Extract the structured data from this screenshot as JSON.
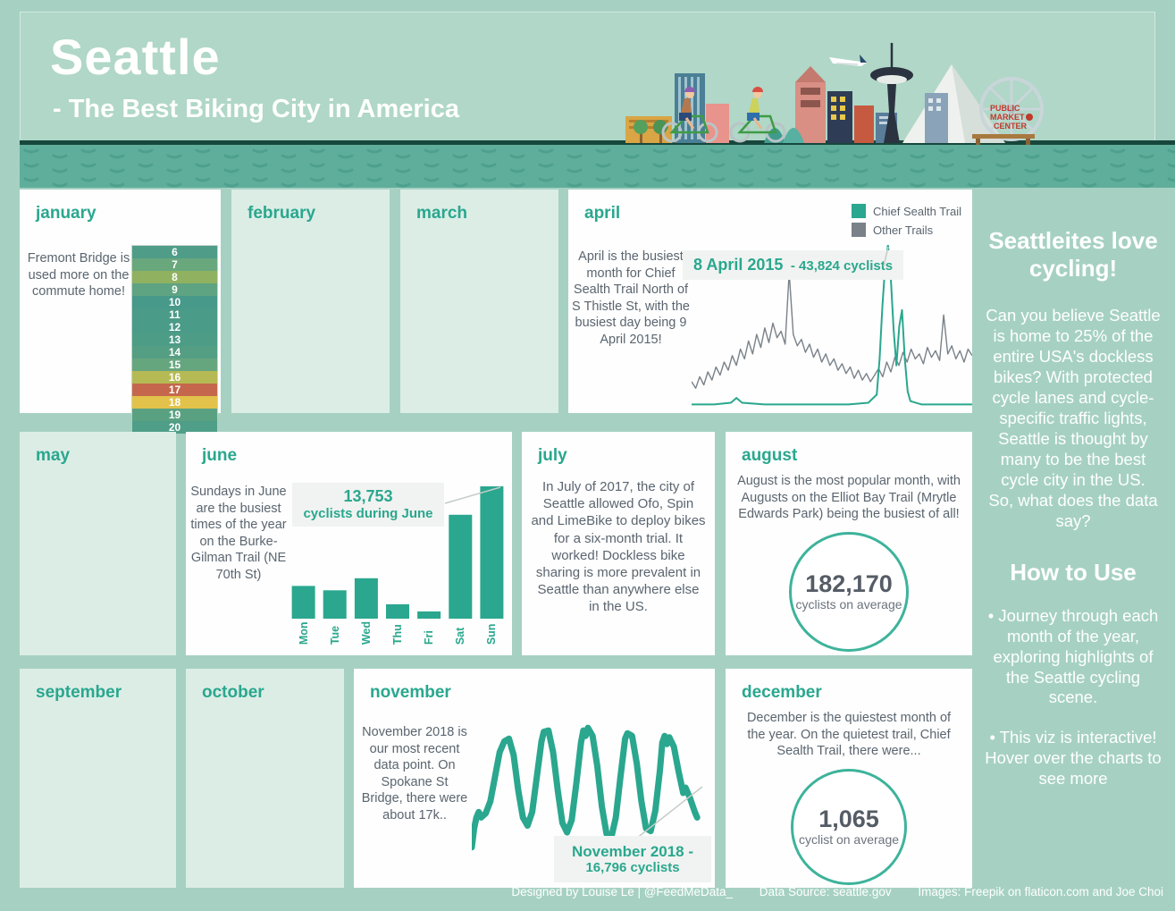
{
  "page": {
    "background": "#a6d1c2",
    "accent": "#2aa78e",
    "text_gray": "#5b6570"
  },
  "header": {
    "title": "Seattle",
    "subtitle": "- The Best Biking City in America",
    "illustration": {
      "sign_lines": [
        "PUBLIC",
        "MARKET",
        "CENTER"
      ]
    }
  },
  "months": {
    "january": {
      "title": "january",
      "text": "Fremont Bridge is used more on the commute home!"
    },
    "february": {
      "title": "february"
    },
    "march": {
      "title": "march"
    },
    "april": {
      "title": "april",
      "text": "April is the busiest month for Chief Sealth Trail North of S Thistle St, with the busiest day being 9 April 2015!",
      "legend": [
        {
          "label": "Chief Sealth Trail",
          "color": "#2aa78e"
        },
        {
          "label": "Other Trails",
          "color": "#7a8189"
        }
      ],
      "callout_date": "8 April 2015",
      "callout_value": "- 43,824 cyclists"
    },
    "may": {
      "title": "may"
    },
    "june": {
      "title": "june",
      "text": "Sundays in June are the busiest times of the year on the Burke-Gilman Trail (NE 70th St)",
      "callout_value": "13,753",
      "callout_label": "cyclists during June"
    },
    "july": {
      "title": "july",
      "text": "In July of 2017, the city of Seattle allowed Ofo, Spin and LimeBike to deploy bikes for a six-month trial. It worked! Dockless bike sharing is more prevalent in Seattle than anywhere else in the US."
    },
    "august": {
      "title": "august",
      "text": "August is the most popular month, with Augusts on the Elliot Bay Trail (Mrytle Edwards Park) being the busiest of all!",
      "stat_value": "182,170",
      "stat_label": "cyclists on average"
    },
    "september": {
      "title": "september"
    },
    "october": {
      "title": "october"
    },
    "november": {
      "title": "november",
      "text": "November 2018 is our most recent data point. On Spokane St Bridge, there were about 17k..",
      "callout_date": "November 2018 -",
      "callout_value": "16,796 cyclists"
    },
    "december": {
      "title": "december",
      "text": "December is the quiestest month of the year. On the quietest trail, Chief Sealth Trail, there were...",
      "stat_value": "1,065",
      "stat_label": "cyclist on average"
    }
  },
  "sidebar": {
    "heading1": "Seattleites love cycling!",
    "para1": "Can you believe Seattle is home to 25% of the entire USA's dockless bikes? With protected cycle lanes and cycle-specific traffic lights, Seattle is thought by many to be the best cycle city in the US.",
    "para1b": "So, what does the data say?",
    "heading2": "How to Use",
    "bullet1": "• Journey through each month of the year, exploring highlights of the Seattle cycling scene.",
    "bullet2": "• This viz is interactive! Hover over the charts to see more"
  },
  "footer": {
    "credit": "Designed by Louise Le | @FeedMeData_",
    "source": "Data Source: seattle.gov",
    "images": "Images: Freepik on flaticon.com and Joe Choi"
  },
  "chart_data": [
    {
      "type": "heatmap",
      "card": "january",
      "note": "hour-of-day heat strip, Fremont Bridge",
      "hours": [
        6,
        7,
        8,
        9,
        10,
        11,
        12,
        13,
        14,
        15,
        16,
        17,
        18,
        19,
        20
      ],
      "colors": [
        "#4f9d89",
        "#69a77d",
        "#8fb160",
        "#5ea382",
        "#47998a",
        "#4a9b88",
        "#4a9b88",
        "#4d9c86",
        "#549e84",
        "#66a67e",
        "#b6ba54",
        "#c4674c",
        "#e2c24a",
        "#5aa182",
        "#4f9e88"
      ]
    },
    {
      "type": "line",
      "card": "april",
      "units": "relative height 0-100 (axes unlabeled)",
      "annotation": {
        "date": "8 April 2015",
        "value": "- 43,824 cyclists"
      },
      "legend_position": "top-right",
      "series": [
        {
          "name": "Other Trails",
          "color": "#7a8189",
          "values": [
            16,
            12,
            19,
            14,
            22,
            17,
            25,
            20,
            28,
            23,
            32,
            26,
            36,
            30,
            41,
            33,
            45,
            37,
            49,
            40,
            52,
            43,
            47,
            39,
            83,
            45,
            38,
            42,
            34,
            39,
            31,
            36,
            28,
            33,
            26,
            30,
            23,
            27,
            21,
            25,
            18,
            23,
            17,
            21,
            16,
            20,
            24,
            19,
            28,
            22,
            31,
            26,
            34,
            28,
            36,
            30,
            33,
            27,
            37,
            31,
            35,
            29,
            57,
            33,
            38,
            30,
            35,
            28,
            36,
            32
          ]
        },
        {
          "name": "Chief Sealth Trail",
          "color": "#2aa78e",
          "points": [
            [
              0,
              2
            ],
            [
              8,
              2
            ],
            [
              14,
              3
            ],
            [
              16,
              6
            ],
            [
              18,
              3
            ],
            [
              26,
              2
            ],
            [
              36,
              2
            ],
            [
              46,
              2
            ],
            [
              56,
              2
            ],
            [
              63,
              3
            ],
            [
              66,
              8
            ],
            [
              67,
              30
            ],
            [
              68,
              62
            ],
            [
              69,
              88
            ],
            [
              70,
              100
            ],
            [
              71,
              80
            ],
            [
              72,
              48
            ],
            [
              73,
              26
            ],
            [
              74,
              50
            ],
            [
              75,
              60
            ],
            [
              76,
              30
            ],
            [
              77,
              10
            ],
            [
              78,
              4
            ],
            [
              82,
              2
            ],
            [
              90,
              2
            ],
            [
              100,
              2
            ]
          ]
        }
      ]
    },
    {
      "type": "bar",
      "card": "june",
      "categories": [
        "Mon",
        "Tue",
        "Wed",
        "Thu",
        "Fri",
        "Sat",
        "Sun"
      ],
      "values": [
        3400,
        2950,
        4200,
        1500,
        750,
        10800,
        13753
      ],
      "bar_color": "#2aa78e",
      "annotation": "13,753 cyclists during June (Sun)",
      "note": "only Sun value labeled; others estimated from bar heights",
      "ylim": [
        0,
        13753
      ]
    },
    {
      "type": "line",
      "card": "november",
      "units": "relative height 0-100 (axes unlabeled)",
      "annotation": {
        "date": "November 2018 -",
        "value": "16,796 cyclists"
      },
      "series": [
        {
          "name": "Spokane St Bridge",
          "color": "#2aa78e",
          "points": [
            [
              0,
              8
            ],
            [
              1,
              22
            ],
            [
              2,
              30
            ],
            [
              3,
              34
            ],
            [
              4,
              30
            ],
            [
              6,
              33
            ],
            [
              8,
              42
            ],
            [
              10,
              60
            ],
            [
              12,
              78
            ],
            [
              14,
              86
            ],
            [
              16,
              88
            ],
            [
              18,
              76
            ],
            [
              20,
              50
            ],
            [
              22,
              30
            ],
            [
              24,
              24
            ],
            [
              26,
              34
            ],
            [
              28,
              60
            ],
            [
              30,
              86
            ],
            [
              31,
              93
            ],
            [
              33,
              94
            ],
            [
              35,
              78
            ],
            [
              37,
              50
            ],
            [
              39,
              26
            ],
            [
              41,
              19
            ],
            [
              43,
              28
            ],
            [
              45,
              55
            ],
            [
              47,
              85
            ],
            [
              48,
              94
            ],
            [
              49,
              90
            ],
            [
              50,
              96
            ],
            [
              52,
              90
            ],
            [
              54,
              68
            ],
            [
              56,
              38
            ],
            [
              58,
              18
            ],
            [
              60,
              15
            ],
            [
              62,
              30
            ],
            [
              64,
              60
            ],
            [
              66,
              88
            ],
            [
              67,
              92
            ],
            [
              69,
              90
            ],
            [
              71,
              70
            ],
            [
              73,
              42
            ],
            [
              75,
              22
            ],
            [
              77,
              20
            ],
            [
              79,
              35
            ],
            [
              81,
              65
            ],
            [
              82,
              85
            ],
            [
              83,
              90
            ],
            [
              84,
              84
            ],
            [
              85,
              89
            ],
            [
              87,
              82
            ],
            [
              89,
              64
            ],
            [
              91,
              48
            ],
            [
              92,
              52
            ],
            [
              94,
              44
            ],
            [
              96,
              34
            ],
            [
              97,
              30
            ]
          ]
        }
      ]
    }
  ]
}
